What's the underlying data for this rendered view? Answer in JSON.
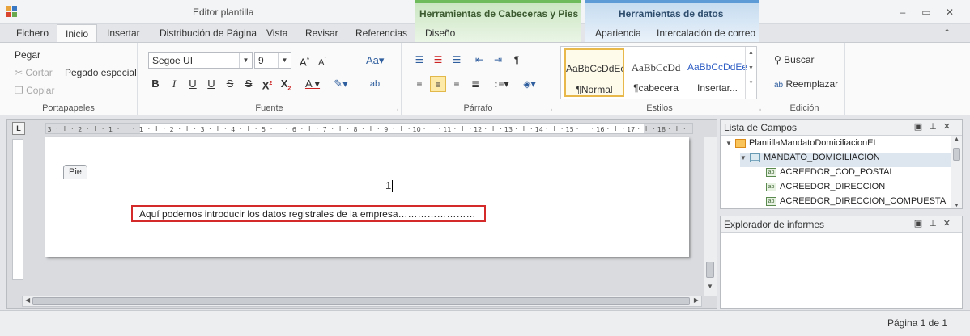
{
  "window": {
    "title": "Editor plantilla",
    "context_tabs": [
      "Herramientas de Cabeceras y Pies",
      "Herramientas de datos"
    ],
    "controls": [
      "–",
      "▭",
      "✕"
    ]
  },
  "tabs": [
    {
      "label": "Fichero"
    },
    {
      "label": "Inicio"
    },
    {
      "label": "Insertar"
    },
    {
      "label": "Distribución de Página"
    },
    {
      "label": "Vista"
    },
    {
      "label": "Revisar"
    },
    {
      "label": "Referencias"
    },
    {
      "label": "Diseño"
    },
    {
      "label": "Apariencia"
    },
    {
      "label": "Intercalación de correo"
    }
  ],
  "ribbon": {
    "clipboard": {
      "paste": "Pegar",
      "cut": "Cortar",
      "copy": "Copiar",
      "paste_special": "Pegado especial",
      "label": "Portapapeles"
    },
    "font": {
      "family": "Segoe UI",
      "size": "9",
      "label": "Fuente"
    },
    "paragraph": {
      "label": "Párrafo"
    },
    "styles": {
      "label": "Estilos",
      "items": [
        {
          "sample": "AaBbCcDdEe",
          "name": "¶Normal"
        },
        {
          "sample": "AaBbCcDd",
          "name": "¶cabecera"
        },
        {
          "sample": "AaBbCcDdEe",
          "name": "Insertar..."
        }
      ]
    },
    "edit": {
      "find": "Buscar",
      "replace": "Reemplazar",
      "label": "Edición"
    }
  },
  "document": {
    "footer_tag": "Pie",
    "page_number": "1",
    "footer_text": "Aquí podemos introducir los datos registrales de la empresa……………………"
  },
  "field_list": {
    "title": "Lista de Campos",
    "items": [
      "PlantillaMandatoDomiciliacionEL",
      "MANDATO_DOMICILIACION",
      "ACREEDOR_COD_POSTAL",
      "ACREEDOR_DIRECCION",
      "ACREEDOR_DIRECCION_COMPUESTA"
    ]
  },
  "report_explorer": {
    "title": "Explorador de informes"
  },
  "status": {
    "page": "Página 1 de 1"
  },
  "ruler_numbers": [
    "3",
    "2",
    "1",
    "1",
    "2",
    "3",
    "4",
    "5",
    "6",
    "7",
    "8",
    "9",
    "10",
    "11",
    "12",
    "13",
    "14",
    "15",
    "16",
    "17",
    "18"
  ]
}
